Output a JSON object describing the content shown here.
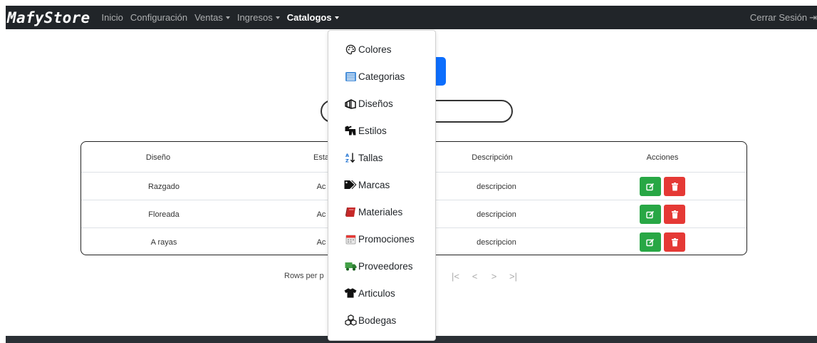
{
  "brand": "MafyStore",
  "nav": {
    "items": [
      {
        "label": "Inicio",
        "dropdown": false,
        "active": false
      },
      {
        "label": "Configuración",
        "dropdown": false,
        "active": false
      },
      {
        "label": "Ventas",
        "dropdown": true,
        "active": false
      },
      {
        "label": "Ingresos",
        "dropdown": true,
        "active": false
      },
      {
        "label": "Catalogos",
        "dropdown": true,
        "active": true
      }
    ],
    "logout_label": "Cerrar Sesión",
    "logout_icon": "logout-arrow-icon"
  },
  "catalog_menu": {
    "items": [
      {
        "label": "Colores",
        "icon": "palette-icon"
      },
      {
        "label": "Categorias",
        "icon": "list-icon"
      },
      {
        "label": "Diseños",
        "icon": "layers-icon"
      },
      {
        "label": "Estilos",
        "icon": "clothes-icon"
      },
      {
        "label": "Tallas",
        "icon": "sort-alpha-icon"
      },
      {
        "label": "Marcas",
        "icon": "tags-icon"
      },
      {
        "label": "Materiales",
        "icon": "book-icon"
      },
      {
        "label": "Promociones",
        "icon": "calendar-icon"
      },
      {
        "label": "Proveedores",
        "icon": "truck-icon"
      },
      {
        "label": "Articulos",
        "icon": "tshirt-icon"
      },
      {
        "label": "Bodegas",
        "icon": "boxes-icon"
      }
    ]
  },
  "table": {
    "headers": [
      "Diseño",
      "Esta",
      "Descripción",
      "Acciones"
    ],
    "rows": [
      {
        "diseno": "Razgado",
        "estado": "Ac",
        "descripcion": "descripcion"
      },
      {
        "diseno": "Floreada",
        "estado": "Ac",
        "descripcion": "descripcion"
      },
      {
        "diseno": "A rayas",
        "estado": "Ac",
        "descripcion": "descripcion"
      }
    ]
  },
  "pagination": {
    "rows_per_page_label": "Rows per p",
    "controls": [
      "|<",
      "<",
      ">",
      ">|"
    ]
  },
  "colors": {
    "navbar": "#212529",
    "primary": "#0d6efd",
    "edit": "#28a745",
    "delete": "#e53935"
  }
}
